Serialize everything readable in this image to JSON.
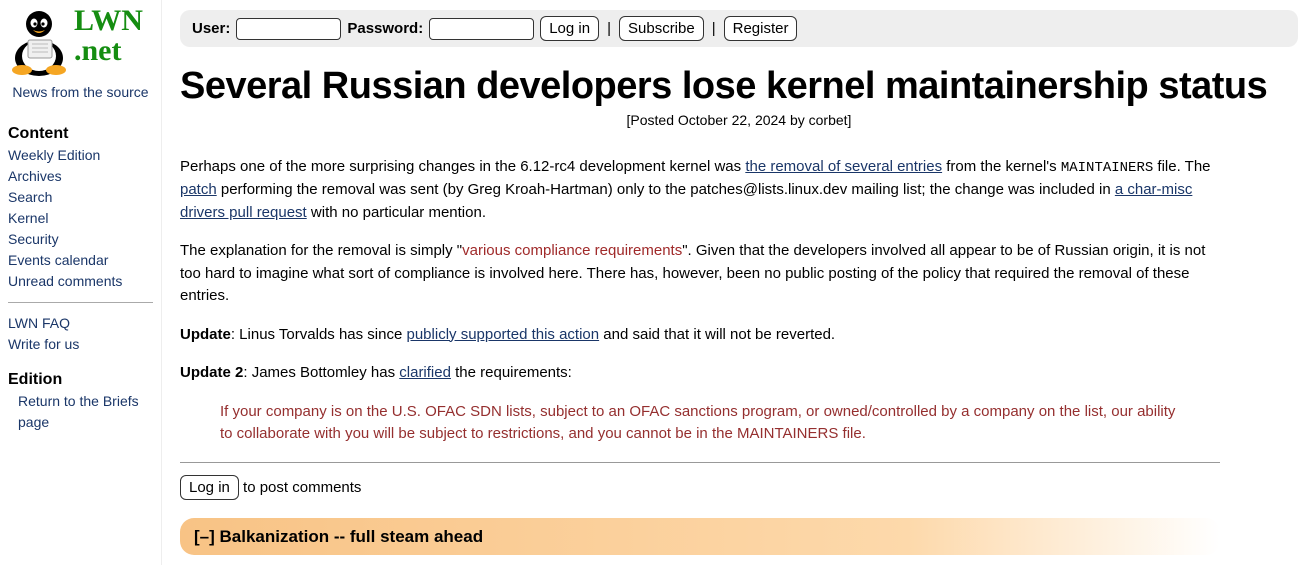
{
  "logo": {
    "top": "LWN",
    "bottom": ".net",
    "tagline": "News from the source"
  },
  "sidebar": {
    "h_content": "Content",
    "links1": [
      "Weekly Edition",
      "Archives",
      "Search",
      "Kernel",
      "Security",
      "Events calendar",
      "Unread comments"
    ],
    "links2": [
      "LWN FAQ",
      "Write for us"
    ],
    "h_edition": "Edition",
    "edition_link": "Return to the Briefs page"
  },
  "login": {
    "user_label": "User:",
    "pass_label": "Password:",
    "login_btn": "Log in",
    "subscribe_btn": "Subscribe",
    "register_btn": "Register",
    "sep": "|"
  },
  "article": {
    "title": "Several Russian developers lose kernel maintainership status",
    "byline": "[Posted October 22, 2024 by corbet]",
    "p1a": "Perhaps one of the more surprising changes in the 6.12-rc4 development kernel was ",
    "p1_link1": "the removal of several entries",
    "p1b": " from the kernel's ",
    "p1_code": "MAINTAINERS",
    "p1c": " file. The ",
    "p1_link2": "patch",
    "p1d": " performing the removal was sent (by Greg Kroah-Hartman) only to the patches@lists.linux.dev mailing list; the change was included in ",
    "p1_link3": "a char-misc drivers pull request",
    "p1e": " with no particular mention.",
    "p2a": "The explanation for the removal is simply \"",
    "p2_red": "various compliance requirements",
    "p2b": "\". Given that the developers involved all appear to be of Russian origin, it is not too hard to imagine what sort of compliance is involved here. There has, however, been no public posting of the policy that required the removal of these entries.",
    "p3_label": "Update",
    "p3a": ": Linus Torvalds has since ",
    "p3_link": "publicly supported this action",
    "p3b": " and said that it will not be reverted.",
    "p4_label": "Update 2",
    "p4a": ": James Bottomley has ",
    "p4_link": "clarified",
    "p4b": " the requirements:",
    "quote": "If your company is on the U.S. OFAC SDN lists, subject to an OFAC sanctions program, or owned/controlled by a company on the list, our ability to collaborate with you will be subject to restrictions, and you cannot be in the MAINTAINERS file.",
    "post_btn": "Log in",
    "post_suffix": " to post comments"
  },
  "comment": {
    "toggle": "[–]",
    "title": "Balkanization -- full steam ahead"
  }
}
